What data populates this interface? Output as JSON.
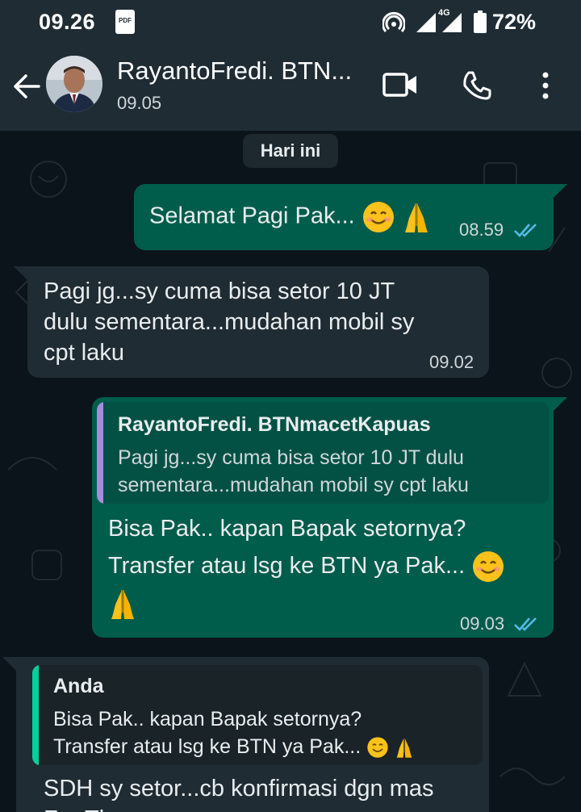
{
  "status_bar": {
    "time": "09.26",
    "pdf_icon_label": "PDF",
    "network_label": "4G",
    "battery_percent": "72%",
    "icons": [
      "pdf-icon",
      "hotspot-icon",
      "signal-icon",
      "lte-signal-icon",
      "battery-icon"
    ]
  },
  "header": {
    "contact_name": "RayantoFredi. BTN...",
    "last_seen": "09.05",
    "icons": [
      "back-arrow-icon",
      "avatar",
      "video-call-icon",
      "voice-call-icon",
      "more-options-icon"
    ]
  },
  "chat": {
    "date_chip": "Hari ini",
    "messages": [
      {
        "direction": "outgoing",
        "text": "Selamat Pagi Pak...",
        "emojis": [
          "smiling-face",
          "folded-hands"
        ],
        "time": "08.59",
        "status": "read"
      },
      {
        "direction": "incoming",
        "lines": [
          "Pagi jg...sy cuma bisa setor 10 JT",
          "dulu sementara...mudahan mobil sy",
          "cpt laku"
        ],
        "time": "09.02"
      },
      {
        "direction": "outgoing",
        "quote": {
          "author": "RayantoFredi. BTNmacetKapuas",
          "lines": [
            "Pagi jg...sy cuma bisa setor 10 JT dulu",
            "sementara...mudahan mobil sy cpt laku"
          ]
        },
        "lines": [
          "Bisa Pak.. kapan Bapak setornya?",
          "Transfer atau lsg ke BTN ya Pak..."
        ],
        "emojis": [
          "smiling-face",
          "folded-hands"
        ],
        "time": "09.03",
        "status": "read"
      },
      {
        "direction": "incoming",
        "quote": {
          "author": "Anda",
          "lines": [
            "Bisa Pak.. kapan Bapak setornya?",
            "Transfer atau lsg ke BTN ya Pak..."
          ],
          "emojis": [
            "smiling-face",
            "folded-hands"
          ]
        },
        "lines": [
          "SDH sy setor...cb konfirmasi dgn mas",
          "Fru Tlp"
        ]
      }
    ]
  },
  "colors": {
    "app_bar": "#1f2c34",
    "background": "#0b141a",
    "outgoing_bubble": "#005c4b",
    "incoming_bubble": "#202c33",
    "read_ticks": "#53bdeb",
    "quote_bar_contact": "#a78bde",
    "quote_bar_you": "#06cf9c"
  }
}
